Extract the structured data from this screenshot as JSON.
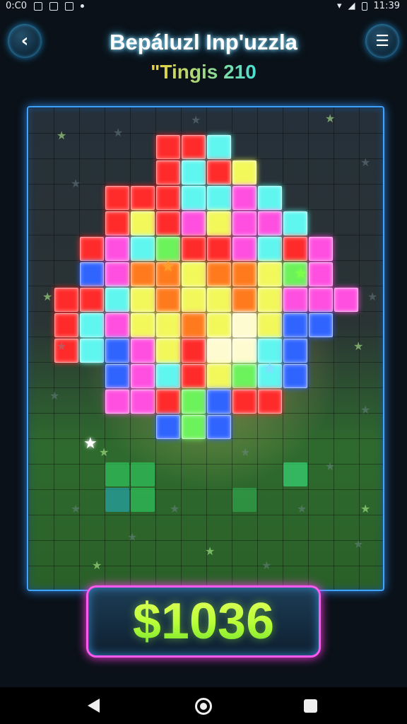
{
  "status_bar": {
    "left_text": "0:C0",
    "time": "11:39"
  },
  "header": {
    "back_icon": "chevron-left-icon",
    "menu_icon": "menu-icon",
    "title": "Bepáluzl Inp'uzzla",
    "subtitle": "\"Tingis 210"
  },
  "board": {
    "border_color": "#3fa4ff",
    "colors": {
      "R": "#ff2b2b",
      "P": "#ff4fe0",
      "C": "#5ff6f0",
      "Y": "#f2f85a",
      "O": "#ff7a1c",
      "B": "#2f64ff",
      "G": "#6cf25a",
      "Q": "#aaff3a",
      "W": "#fffbd0"
    },
    "tiles": [
      [
        "R",
        "R",
        "C"
      ],
      [
        "R",
        "C",
        "R",
        "Y"
      ],
      [
        "R",
        "R",
        "R",
        "C",
        "C",
        "P",
        "C"
      ],
      [
        "R",
        "Y",
        "R",
        "P",
        "Y",
        "P",
        "P",
        "C"
      ],
      [
        "R",
        "P",
        "C",
        "G",
        "R",
        "R",
        "P",
        "C",
        "R",
        "P"
      ],
      [
        "B",
        "P",
        "O",
        "O",
        "Y",
        "O",
        "O",
        "Y",
        "G",
        "P"
      ],
      [
        "R",
        "R",
        "C",
        "Y",
        "O",
        "Y",
        "Y",
        "O",
        "Y",
        "P",
        "P",
        "P"
      ],
      [
        "R",
        "C",
        "P",
        "Y",
        "Y",
        "O",
        "Y",
        "W",
        "Y",
        "B",
        "B"
      ],
      [
        "R",
        "C",
        "B",
        "P",
        "Y",
        "R",
        "W",
        "W",
        "C",
        "B"
      ],
      [
        "B",
        "P",
        "C",
        "R",
        "Y",
        "G",
        "C",
        "B"
      ],
      [
        "P",
        "P",
        "R",
        "G",
        "B",
        "R",
        "R"
      ],
      [
        "B",
        "G",
        "B"
      ]
    ]
  },
  "score": {
    "value": "$1036",
    "border_color": "#ff5af0"
  }
}
